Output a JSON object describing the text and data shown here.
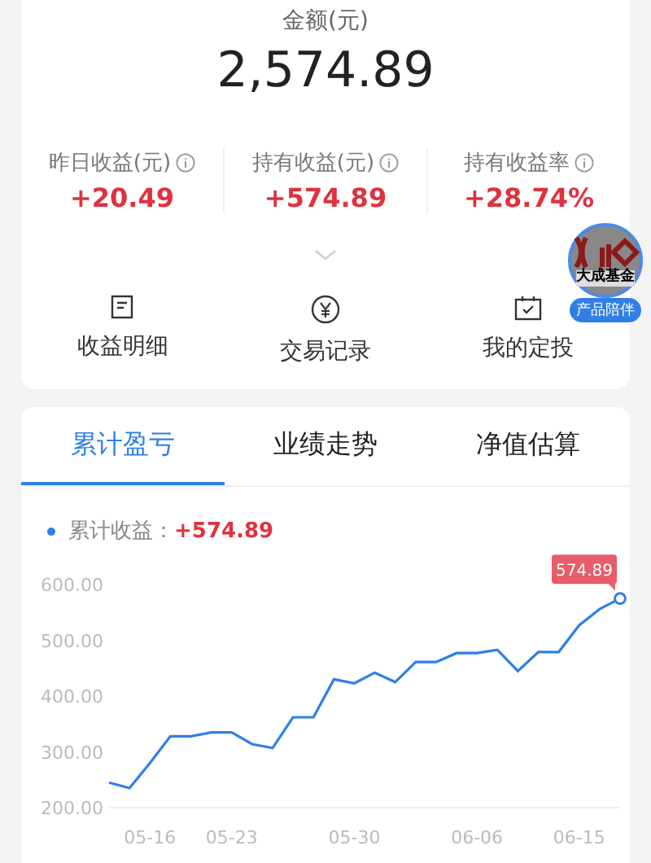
{
  "summary": {
    "amount_label": "金额(元)",
    "amount": "2,574.89",
    "stats": [
      {
        "label": "昨日收益(元)",
        "value": "+20.49"
      },
      {
        "label": "持有收益(元)",
        "value": "+574.89"
      },
      {
        "label": "持有收益率",
        "value": "+28.74%"
      }
    ]
  },
  "actions": [
    {
      "kind": "detail",
      "label": "收益明细"
    },
    {
      "kind": "records",
      "label": "交易记录"
    },
    {
      "kind": "plan",
      "label": "我的定投"
    }
  ],
  "floating_badge": {
    "logo_text": "大成基金",
    "tag": "产品陪伴"
  },
  "tabs": [
    {
      "label": "累计盈亏",
      "selected": true
    },
    {
      "label": "业绩走势",
      "selected": false
    },
    {
      "label": "净值估算",
      "selected": false
    }
  ],
  "legend": {
    "separator": "：",
    "value": "+574.89"
  },
  "chart_data": {
    "type": "line",
    "categories": [
      null,
      null,
      "05-16",
      null,
      null,
      null,
      "05-23",
      null,
      null,
      null,
      null,
      null,
      "05-30",
      null,
      null,
      null,
      null,
      null,
      "06-06",
      null,
      null,
      null,
      null,
      "06-15",
      null,
      null
    ],
    "series": [
      {
        "name": "累计收益",
        "color": "#2f7fe6",
        "values": [
          245,
          235,
          280,
          328,
          328,
          335,
          335,
          314,
          307,
          362,
          362,
          430,
          423,
          442,
          425,
          461,
          461,
          477,
          477,
          483,
          445,
          479,
          479,
          527,
          556,
          574.89
        ]
      }
    ],
    "ylim": [
      200,
      600
    ],
    "yticks": [
      {
        "value": 200,
        "label": "200.00"
      },
      {
        "value": 300,
        "label": "300.00"
      },
      {
        "value": 400,
        "label": "400.00"
      },
      {
        "value": 500,
        "label": "500.00"
      },
      {
        "value": 600,
        "label": "600.00"
      }
    ],
    "annotations": [
      "574.89"
    ]
  }
}
